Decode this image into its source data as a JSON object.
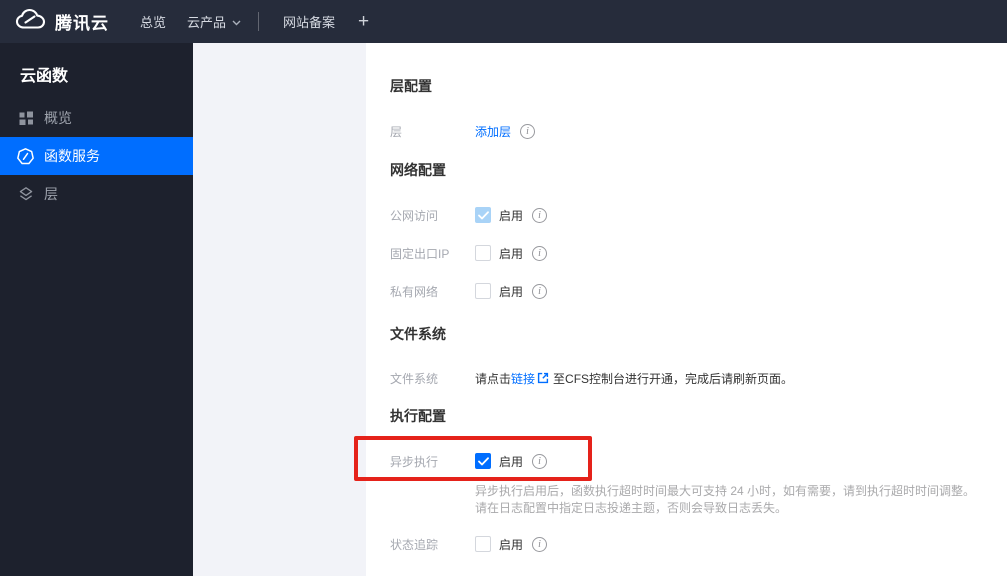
{
  "topbar": {
    "brand": "腾讯云",
    "nav_overview": "总览",
    "nav_products": "云产品",
    "nav_beian": "网站备案",
    "plus": "+"
  },
  "sidebar": {
    "title": "云函数",
    "items": [
      {
        "label": "概览",
        "icon": "grid-icon",
        "active": false
      },
      {
        "label": "函数服务",
        "icon": "function-icon",
        "active": true
      },
      {
        "label": "层",
        "icon": "layers-icon",
        "active": false
      }
    ]
  },
  "main": {
    "layer_section": {
      "heading": "层配置",
      "label": "层",
      "add_layer_link": "添加层"
    },
    "network_section": {
      "heading": "网络配置",
      "rows": [
        {
          "label": "公网访问",
          "enable_label": "启用",
          "checked": true,
          "disabled": true
        },
        {
          "label": "固定出口IP",
          "enable_label": "启用",
          "checked": false,
          "disabled": false
        },
        {
          "label": "私有网络",
          "enable_label": "启用",
          "checked": false,
          "disabled": false
        }
      ]
    },
    "file_section": {
      "heading": "文件系统",
      "label": "文件系统",
      "text_before": "请点击",
      "link": "链接",
      "link_icon": "external-link-icon",
      "text_after": "至CFS控制台进行开通，完成后请刷新页面。"
    },
    "exec_section": {
      "heading": "执行配置",
      "async_row": {
        "label": "异步执行",
        "enable_label": "启用",
        "checked": true
      },
      "desc_line1": "异步执行启用后，函数执行超时时间最大可支持 24 小时，如有需要，请到执行超时时间调整。",
      "desc_line2": "请在日志配置中指定日志投递主题，否则会导致日志丢失。",
      "status_row": {
        "label": "状态追踪",
        "enable_label": "启用",
        "checked": false
      }
    }
  },
  "colors": {
    "accent_blue": "#006eff",
    "topbar_bg": "#262c3b",
    "sidebar_bg": "#1d212d",
    "panel_gray": "#f2f3f8",
    "highlight_red": "#e5221a",
    "disabled_check_blue": "#a9d3f7"
  }
}
